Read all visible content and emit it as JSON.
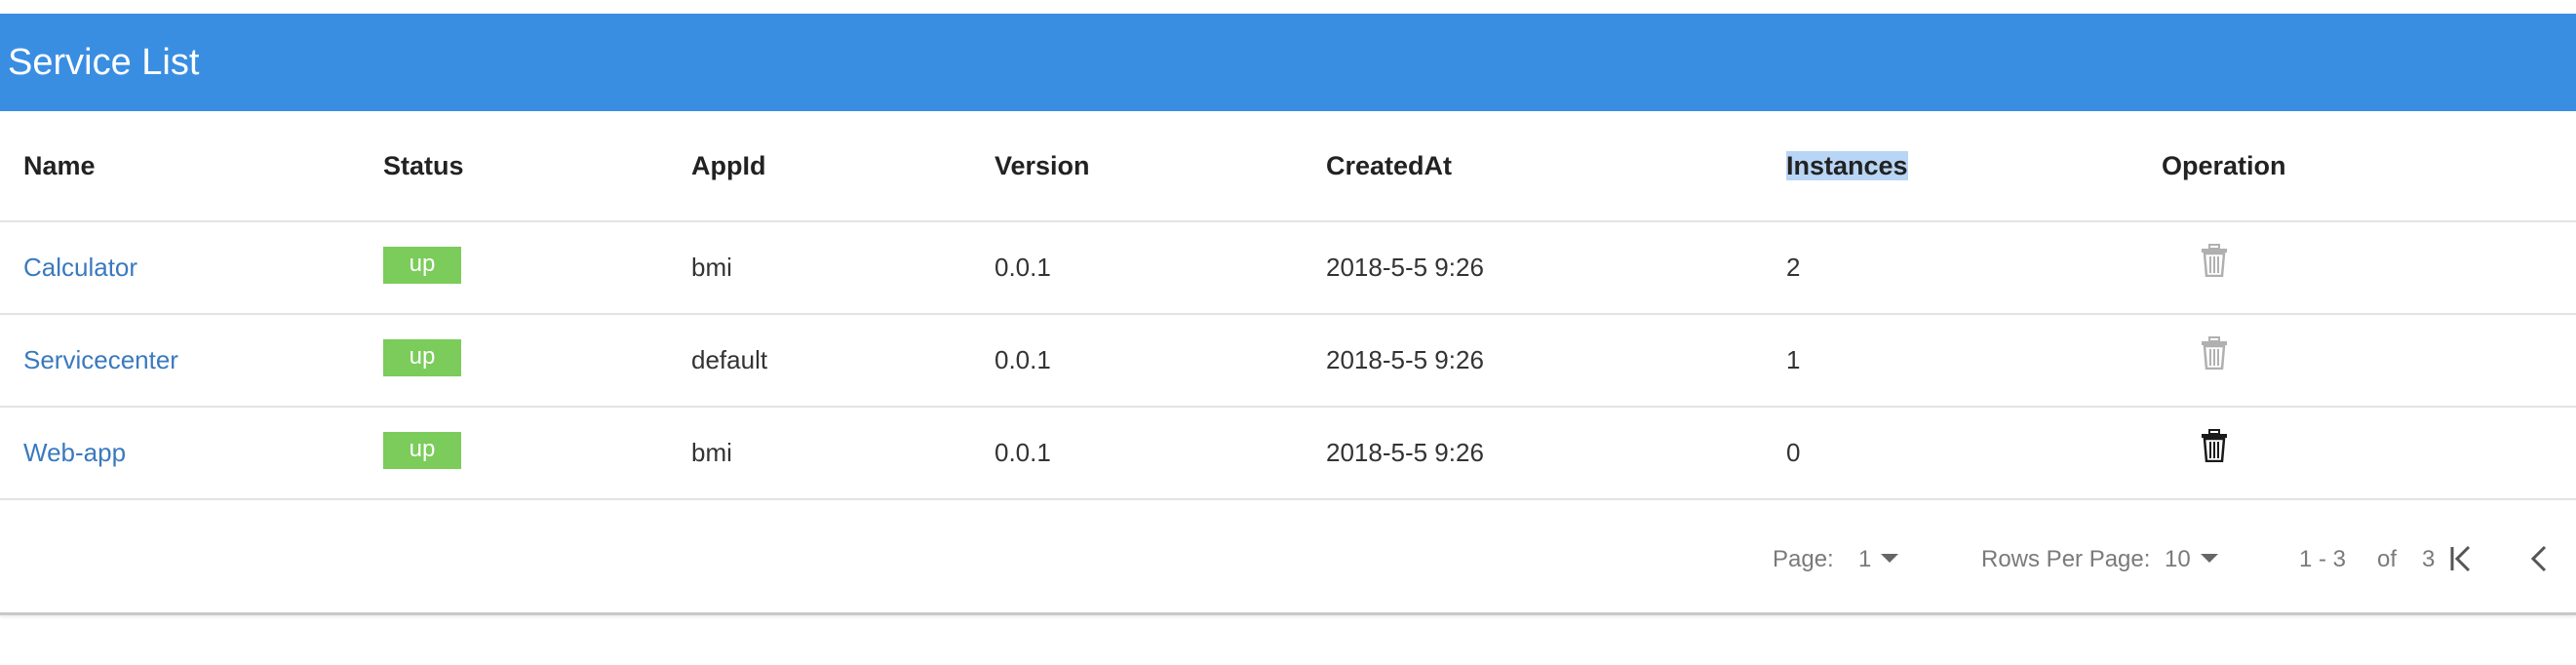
{
  "header": {
    "title": "Service List"
  },
  "table": {
    "columns": [
      "Name",
      "Status",
      "AppId",
      "Version",
      "CreatedAt",
      "Instances",
      "Operation"
    ],
    "rows": [
      {
        "name": "Calculator",
        "status": "up",
        "appid": "bmi",
        "version": "0.0.1",
        "created": "2018-5-5 9:26",
        "instances": "2",
        "delete_enabled": false
      },
      {
        "name": "Servicecenter",
        "status": "up",
        "appid": "default",
        "version": "0.0.1",
        "created": "2018-5-5 9:26",
        "instances": "1",
        "delete_enabled": false
      },
      {
        "name": "Web-app",
        "status": "up",
        "appid": "bmi",
        "version": "0.0.1",
        "created": "2018-5-5 9:26",
        "instances": "0",
        "delete_enabled": true
      }
    ]
  },
  "footer": {
    "page_label": "Page:",
    "page_value": "1",
    "rows_label": "Rows Per Page:",
    "rows_value": "10",
    "range": "1 - 3",
    "of_label": "of",
    "total": "3"
  },
  "colors": {
    "header_bg": "#3a8ee2",
    "status_up": "#7bcc5a",
    "link": "#3a79bf",
    "selection_highlight": "#b9d5f5"
  },
  "icons": [
    "trash-icon",
    "first-page-icon",
    "prev-page-icon",
    "dropdown-caret-icon"
  ]
}
